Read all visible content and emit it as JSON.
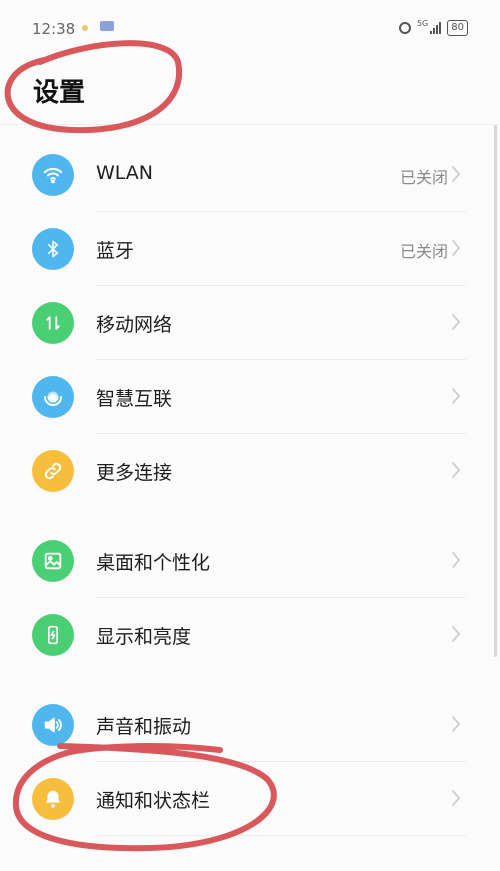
{
  "status_bar": {
    "time": "12:38",
    "notification_icons": [
      "notification-dot-icon",
      "mail-icon"
    ],
    "alarm_icon": "alarm-icon",
    "network": "5G",
    "battery": "80"
  },
  "page": {
    "title": "设置"
  },
  "settings": [
    {
      "label": "WLAN",
      "value": "已关闭",
      "icon": "wifi-icon",
      "color": "#4fb6ee"
    },
    {
      "label": "蓝牙",
      "value": "已关闭",
      "icon": "bluetooth-icon",
      "color": "#4fb6ee"
    },
    {
      "label": "移动网络",
      "value": "",
      "icon": "mobile-data-icon",
      "color": "#4bcf74"
    },
    {
      "label": "智慧互联",
      "value": "",
      "icon": "smart-connect-icon",
      "color": "#4fb6ee"
    },
    {
      "label": "更多连接",
      "value": "",
      "icon": "link-icon",
      "color": "#f6be3c"
    },
    {
      "label": "桌面和个性化",
      "value": "",
      "icon": "image-icon",
      "color": "#4bcf74"
    },
    {
      "label": "显示和亮度",
      "value": "",
      "icon": "display-icon",
      "color": "#4bcf74"
    },
    {
      "label": "声音和振动",
      "value": "",
      "icon": "speaker-icon",
      "color": "#4fb6ee"
    },
    {
      "label": "通知和状态栏",
      "value": "",
      "icon": "bell-icon",
      "color": "#f6be3c"
    }
  ],
  "annotation_color": "#d9585c"
}
